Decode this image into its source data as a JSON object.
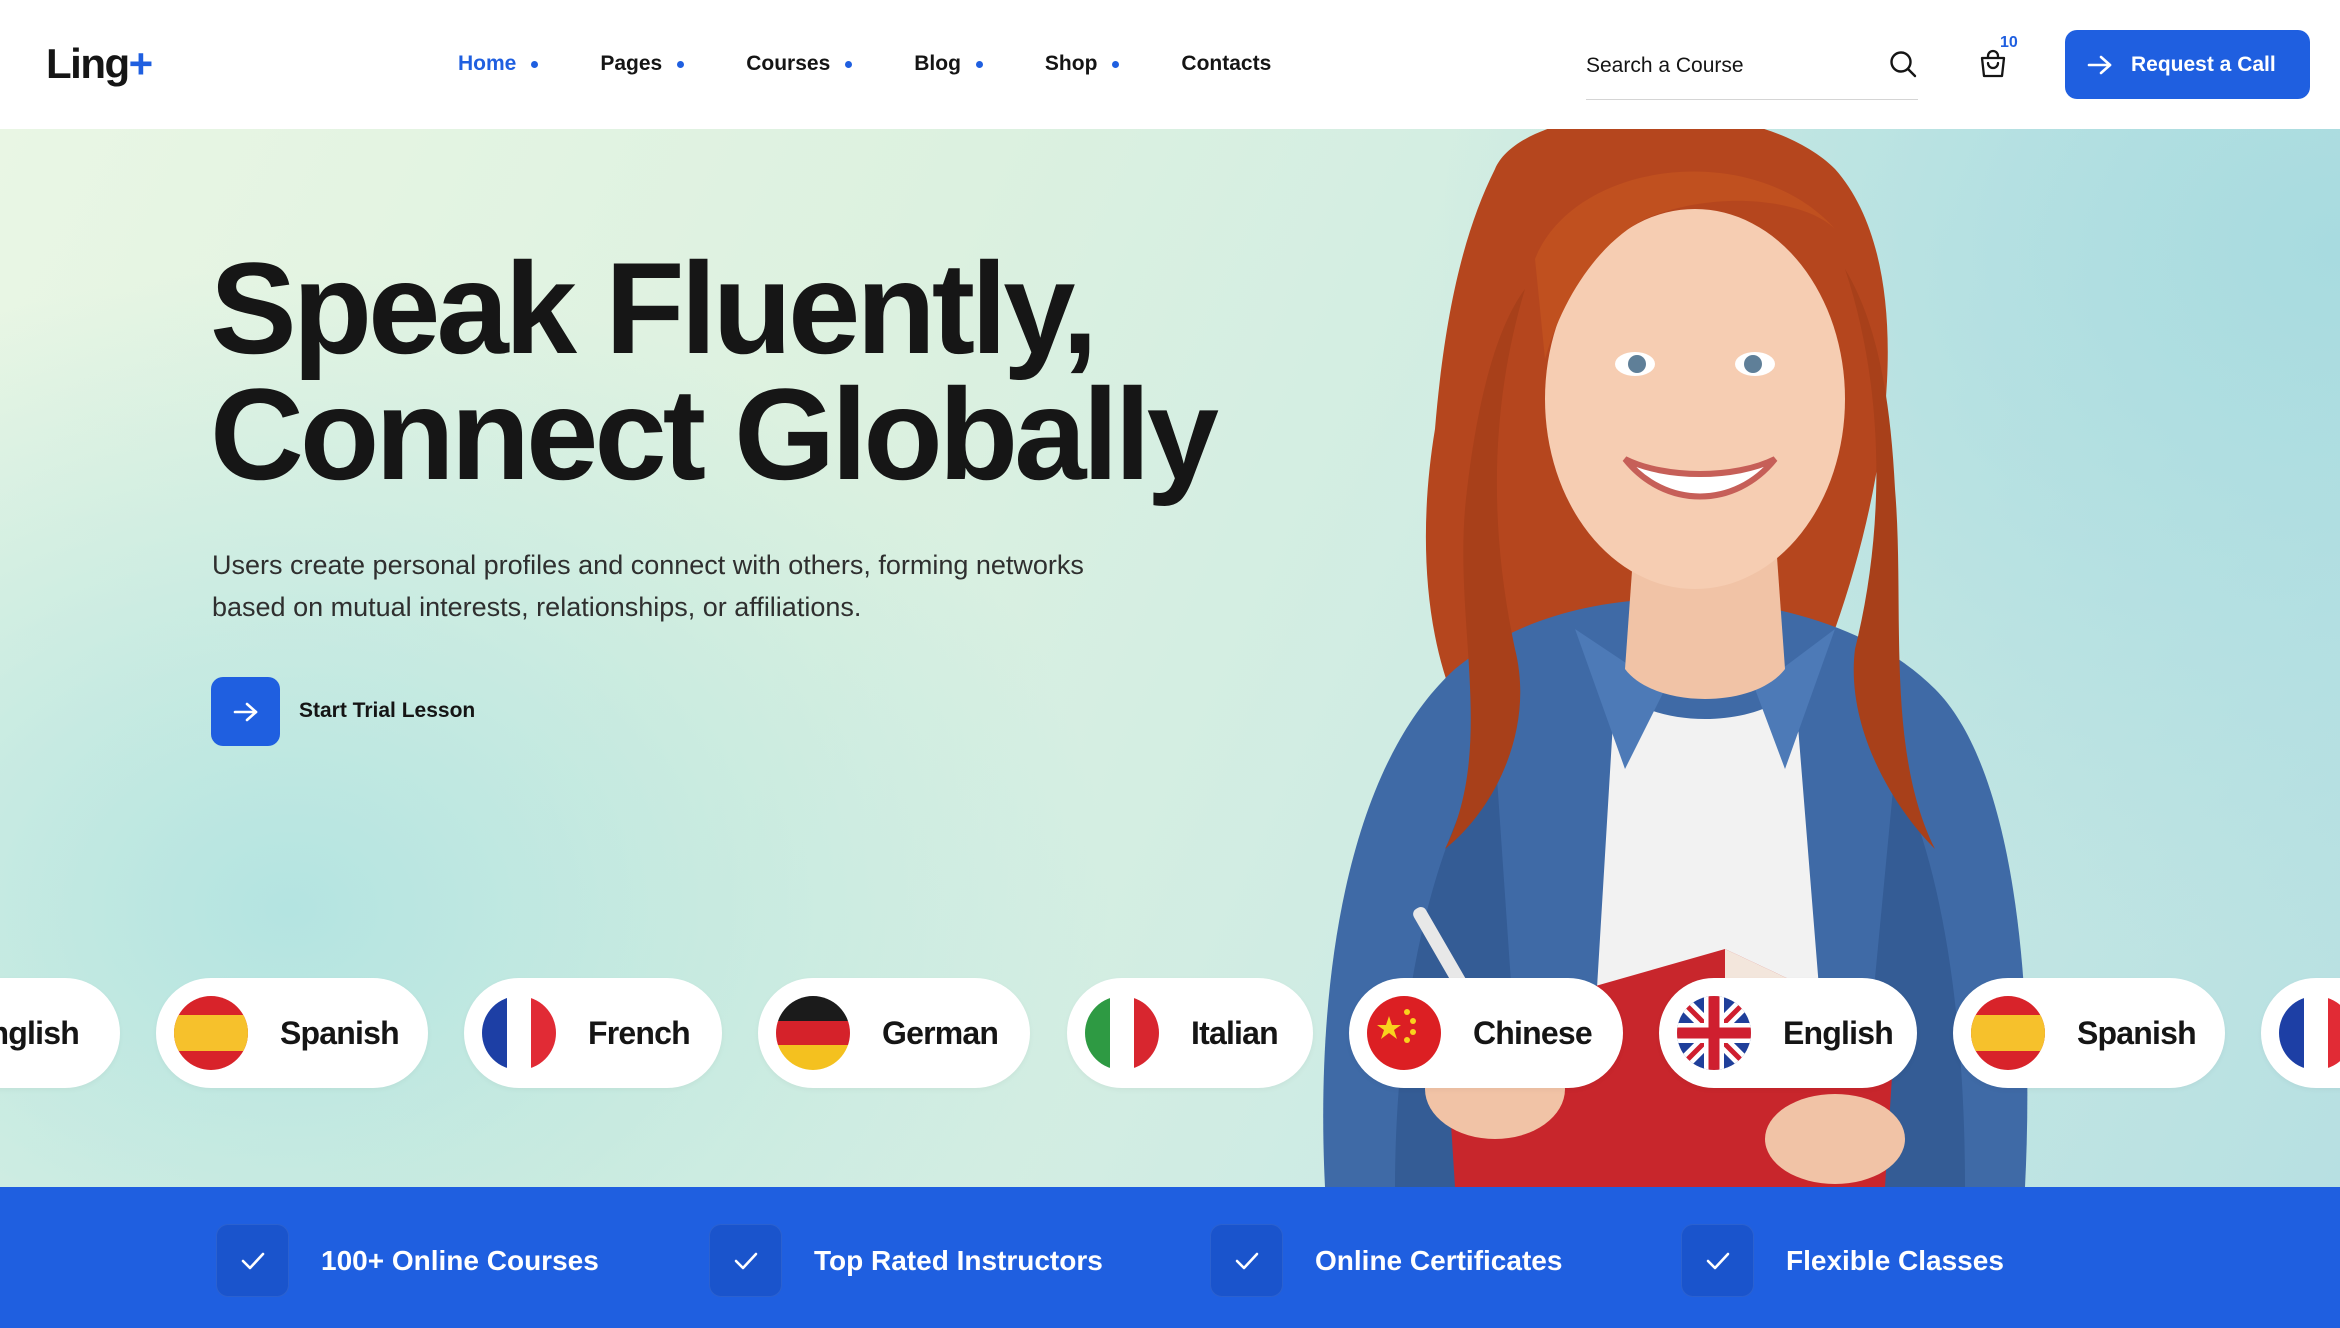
{
  "brand": {
    "name": "Ling",
    "mark": "+"
  },
  "nav": {
    "items": [
      {
        "label": "Home",
        "active": true,
        "dropdown": true
      },
      {
        "label": "Pages",
        "active": false,
        "dropdown": true
      },
      {
        "label": "Courses",
        "active": false,
        "dropdown": true
      },
      {
        "label": "Blog",
        "active": false,
        "dropdown": true
      },
      {
        "label": "Shop",
        "active": false,
        "dropdown": true
      },
      {
        "label": "Contacts",
        "active": false,
        "dropdown": false
      }
    ]
  },
  "search": {
    "placeholder": "Search a Course",
    "icon": "search-icon"
  },
  "cart": {
    "icon": "cart-icon",
    "count": "10"
  },
  "cta": {
    "label": "Request a Call",
    "icon": "arrow-right-icon"
  },
  "hero": {
    "title_line1": "Speak Fluently,",
    "title_line2": "Connect Globally",
    "description": "Users create personal profiles and connect with others, forming networks based on mutual interests, relationships, or affiliations.",
    "trial_label": "Start Trial Lesson"
  },
  "languages": [
    {
      "label": "English",
      "flag": "uk-flag"
    },
    {
      "label": "Spanish",
      "flag": "spain-flag"
    },
    {
      "label": "French",
      "flag": "france-flag"
    },
    {
      "label": "German",
      "flag": "germany-flag"
    },
    {
      "label": "Italian",
      "flag": "italy-flag"
    },
    {
      "label": "Chinese",
      "flag": "china-flag"
    },
    {
      "label": "English",
      "flag": "uk-flag"
    },
    {
      "label": "Spanish",
      "flag": "spain-flag"
    },
    {
      "label": "",
      "flag": "france-flag"
    }
  ],
  "features": [
    {
      "label": "100+ Online Courses",
      "icon": "check-icon"
    },
    {
      "label": "Top Rated Instructors",
      "icon": "check-icon"
    },
    {
      "label": "Online Certificates",
      "icon": "check-icon"
    },
    {
      "label": "Flexible Classes",
      "icon": "check-icon"
    }
  ],
  "colors": {
    "accent": "#1f5fe0",
    "text": "#151515",
    "feature_bar": "#1f5fe0"
  }
}
